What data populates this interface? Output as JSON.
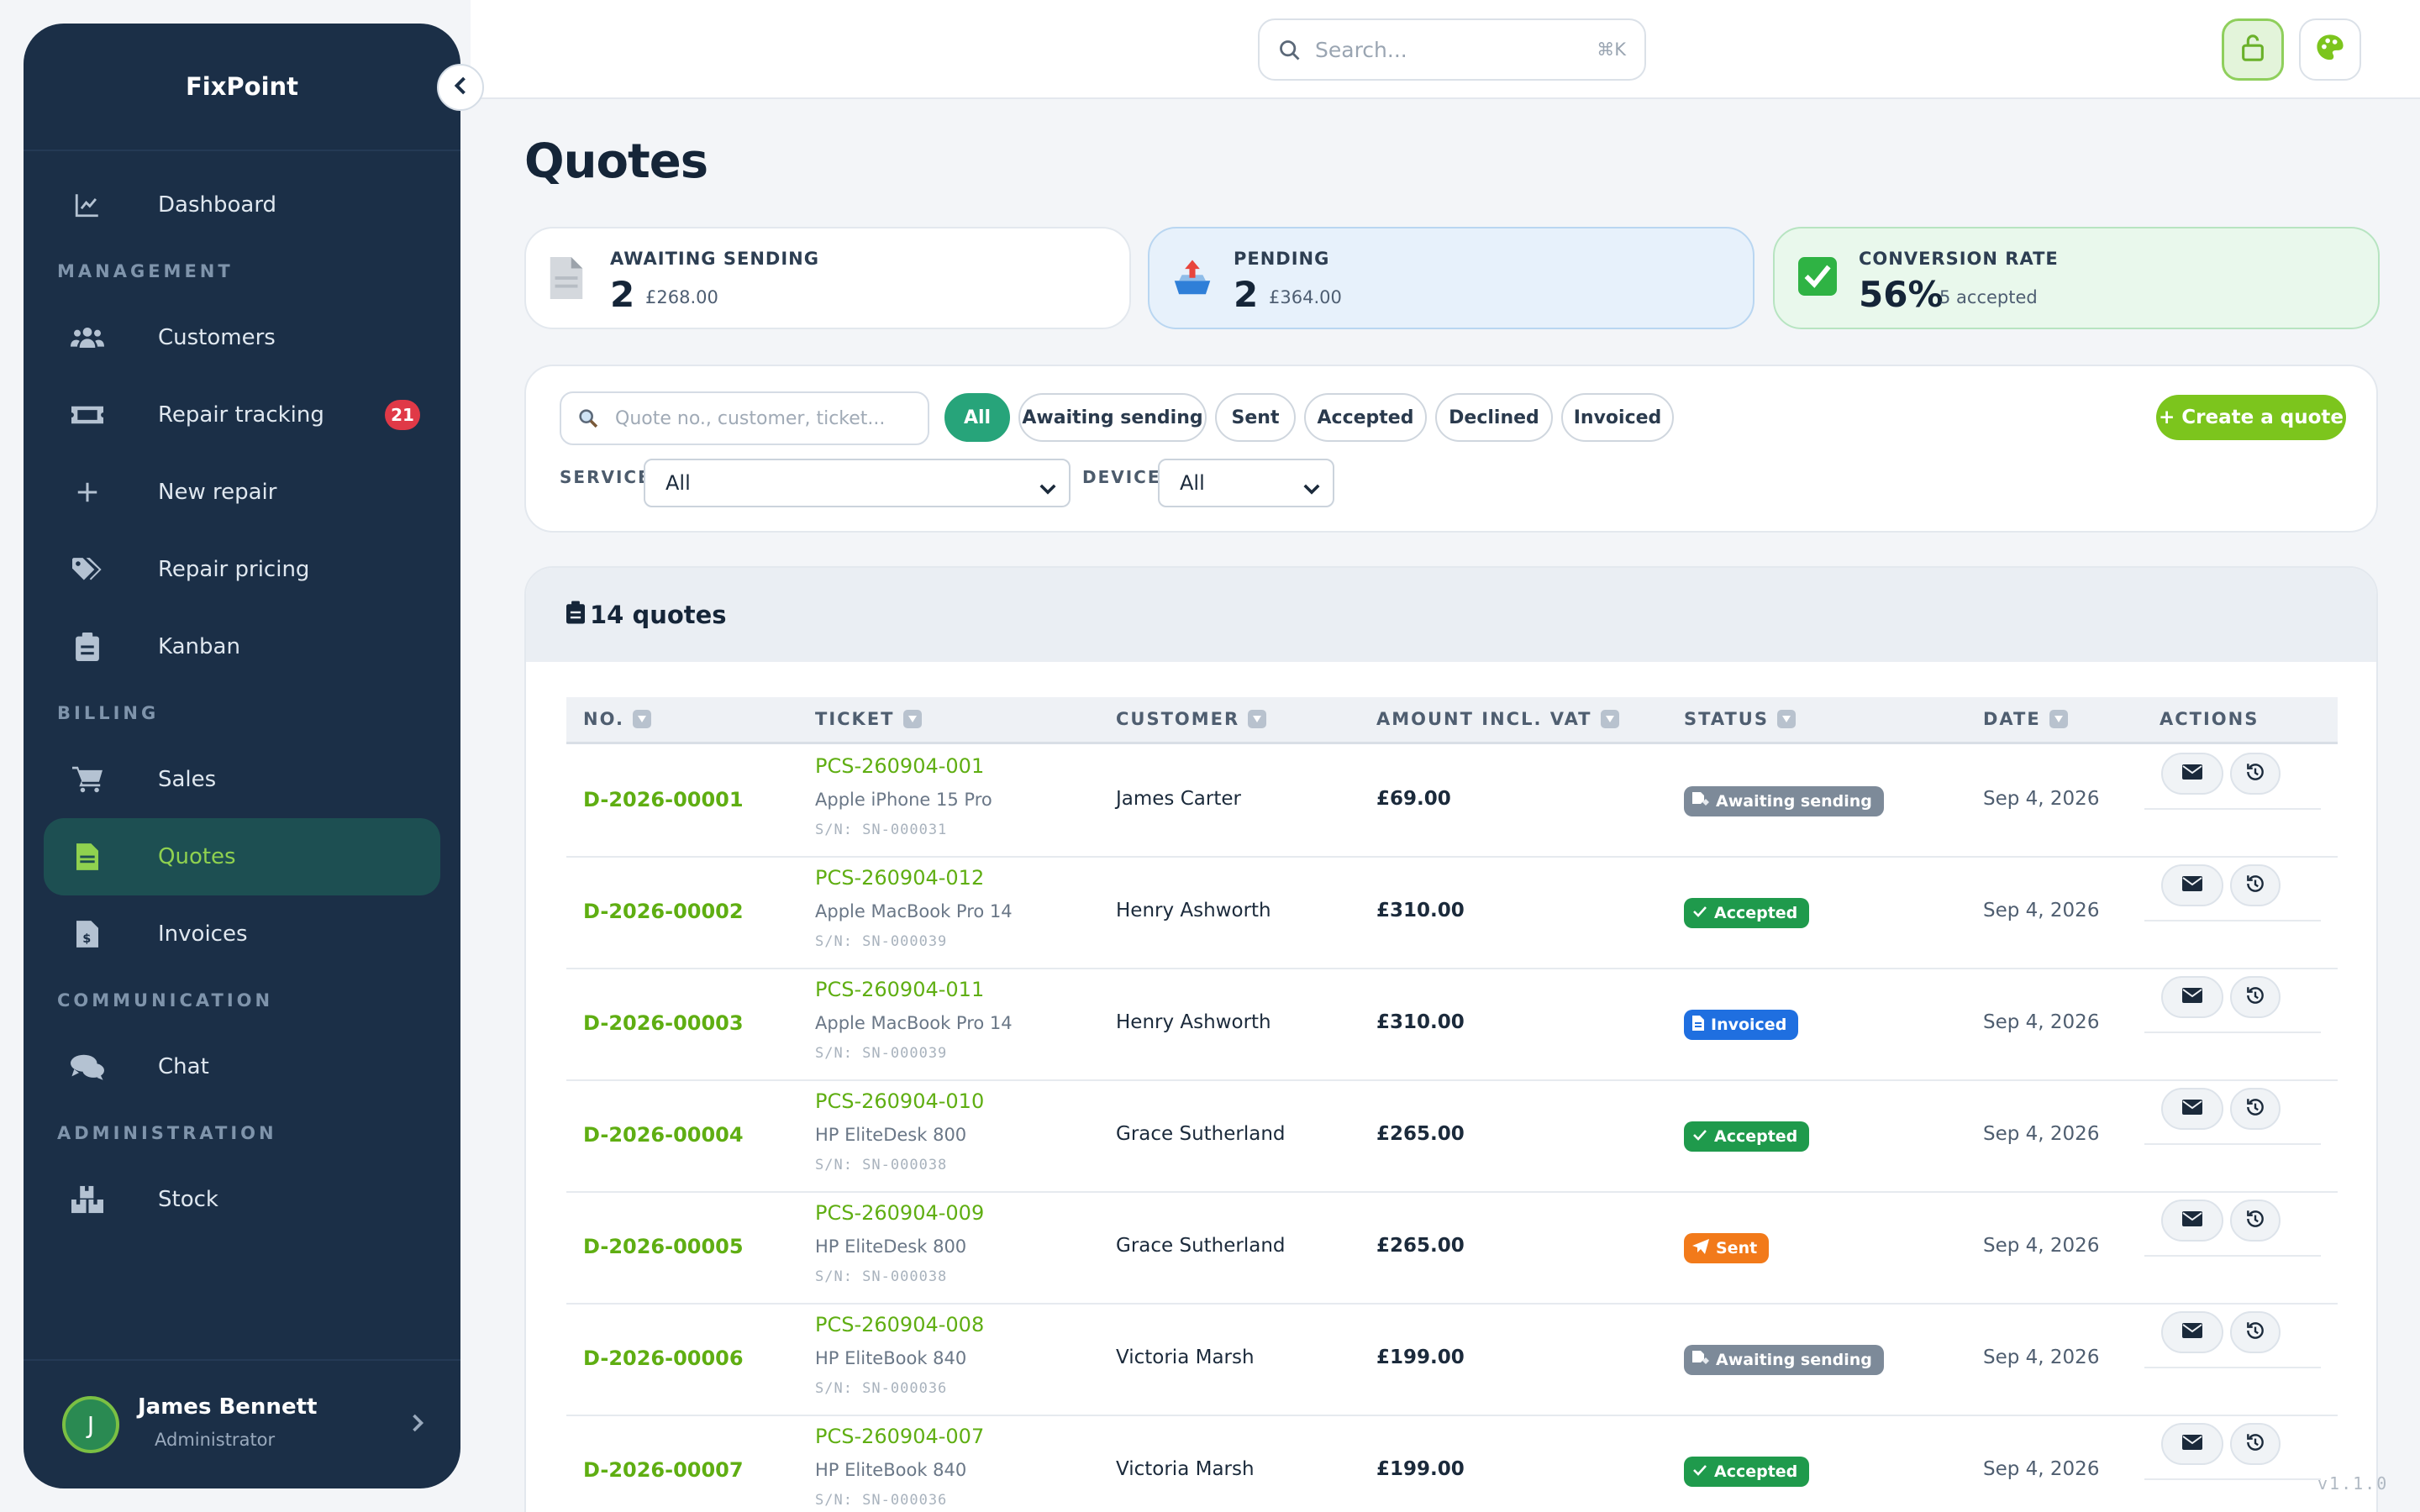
{
  "app": {
    "name": "FixPoint",
    "version": "v1.1.0"
  },
  "sidebar": {
    "top_item": {
      "label": "Dashboard",
      "icon": "chart-line-icon"
    },
    "sections": [
      {
        "title": "MANAGEMENT",
        "items": [
          {
            "label": "Customers",
            "icon": "users-icon"
          },
          {
            "label": "Repair tracking",
            "icon": "ticket-icon",
            "badge": "21"
          },
          {
            "label": "New repair",
            "icon": "plus-icon"
          },
          {
            "label": "Repair pricing",
            "icon": "tags-icon"
          },
          {
            "label": "Kanban",
            "icon": "clipboard-icon"
          }
        ]
      },
      {
        "title": "BILLING",
        "items": [
          {
            "label": "Sales",
            "icon": "cart-icon"
          },
          {
            "label": "Quotes",
            "icon": "file-icon",
            "active": true
          },
          {
            "label": "Invoices",
            "icon": "invoice-icon"
          }
        ]
      },
      {
        "title": "COMMUNICATION",
        "items": [
          {
            "label": "Chat",
            "icon": "comments-icon"
          }
        ]
      },
      {
        "title": "ADMINISTRATION",
        "items": [
          {
            "label": "Stock",
            "icon": "boxes-icon"
          }
        ]
      }
    ],
    "user": {
      "initial": "J",
      "name": "James Bennett",
      "role": "Administrator"
    }
  },
  "topbar": {
    "search_placeholder": "Search...",
    "shortcut": "⌘K"
  },
  "page": {
    "title": "Quotes"
  },
  "stats": {
    "awaiting": {
      "label": "AWAITING SENDING",
      "value": "2",
      "sub": "£268.00"
    },
    "pending": {
      "label": "PENDING",
      "value": "2",
      "sub": "£364.00"
    },
    "conversion": {
      "label": "CONVERSION RATE",
      "value": "56%",
      "sub": "5 accepted"
    }
  },
  "filters": {
    "search_placeholder": "Quote no., customer, ticket...",
    "chips": [
      "All",
      "Awaiting sending",
      "Sent",
      "Accepted",
      "Declined",
      "Invoiced"
    ],
    "active_chip": "All",
    "create_label": "+ Create a quote",
    "service_label": "SERVICE",
    "service_value": "All",
    "device_label": "DEVICE",
    "device_value": "All"
  },
  "table": {
    "count_label": "14 quotes",
    "columns": [
      "NO.",
      "TICKET",
      "CUSTOMER",
      "AMOUNT INCL. VAT",
      "STATUS",
      "DATE",
      "ACTIONS"
    ],
    "rows": [
      {
        "no": "D-2026-00001",
        "ticket": "PCS-260904-001",
        "device": "Apple iPhone 15 Pro",
        "serial": "S/N: SN-000031",
        "customer": "James Carter",
        "amount": "£69.00",
        "status": "Awaiting sending",
        "date": "Sep 4, 2026"
      },
      {
        "no": "D-2026-00002",
        "ticket": "PCS-260904-012",
        "device": "Apple MacBook Pro 14",
        "serial": "S/N: SN-000039",
        "customer": "Henry Ashworth",
        "amount": "£310.00",
        "status": "Accepted",
        "date": "Sep 4, 2026"
      },
      {
        "no": "D-2026-00003",
        "ticket": "PCS-260904-011",
        "device": "Apple MacBook Pro 14",
        "serial": "S/N: SN-000039",
        "customer": "Henry Ashworth",
        "amount": "£310.00",
        "status": "Invoiced",
        "date": "Sep 4, 2026"
      },
      {
        "no": "D-2026-00004",
        "ticket": "PCS-260904-010",
        "device": "HP EliteDesk 800",
        "serial": "S/N: SN-000038",
        "customer": "Grace Sutherland",
        "amount": "£265.00",
        "status": "Accepted",
        "date": "Sep 4, 2026"
      },
      {
        "no": "D-2026-00005",
        "ticket": "PCS-260904-009",
        "device": "HP EliteDesk 800",
        "serial": "S/N: SN-000038",
        "customer": "Grace Sutherland",
        "amount": "£265.00",
        "status": "Sent",
        "date": "Sep 4, 2026"
      },
      {
        "no": "D-2026-00006",
        "ticket": "PCS-260904-008",
        "device": "HP EliteBook 840",
        "serial": "S/N: SN-000036",
        "customer": "Victoria Marsh",
        "amount": "£199.00",
        "status": "Awaiting sending",
        "date": "Sep 4, 2026"
      },
      {
        "no": "D-2026-00007",
        "ticket": "PCS-260904-007",
        "device": "HP EliteBook 840",
        "serial": "S/N: SN-000036",
        "customer": "Victoria Marsh",
        "amount": "£199.00",
        "status": "Accepted",
        "date": "Sep 4, 2026"
      }
    ]
  },
  "colors": {
    "sidebar": "#1b2f47",
    "accent_green": "#7cc51d",
    "chip_active": "#27a47a",
    "status_awaiting": "#7d8a99",
    "status_accepted": "#1f9a4c",
    "status_invoiced": "#1f6fe0",
    "status_sent": "#f27a1a",
    "badge_red": "#e03947"
  }
}
